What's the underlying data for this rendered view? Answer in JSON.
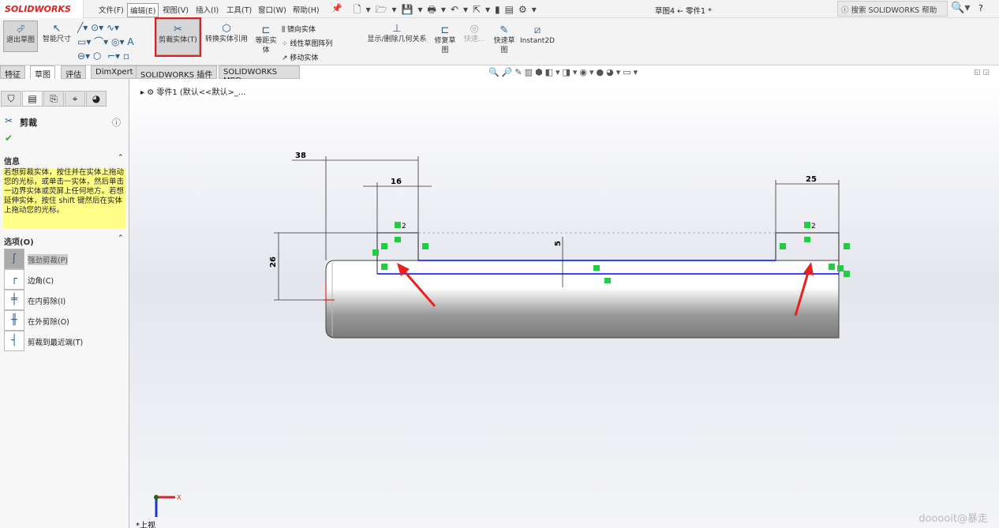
{
  "app": {
    "logo": "SOLIDWORKS",
    "title": "草图4 ← 零件1 *",
    "search_placeholder": "搜索 SOLIDWORKS 帮助",
    "help": "?"
  },
  "menu": [
    "文件(F)",
    "编辑(E)",
    "视图(V)",
    "插入(I)",
    "工具(T)",
    "窗口(W)",
    "帮助(H)"
  ],
  "ribbon": {
    "exit_sketch": "退出草图",
    "smart_dim": "智能尺寸",
    "trim": "剪裁实体(T)",
    "convert": "转换实体引用",
    "offset": "等距实体",
    "mirror": "镜向实体",
    "linear_pattern": "线性草图阵列",
    "move": "移动实体",
    "relations": "显示/删除几何关系",
    "repair": "修复草图",
    "quick_snap": "快速...",
    "rapid_sketch": "快速草图",
    "instant2d": "Instant2D"
  },
  "tabs": [
    "特征",
    "草图",
    "评估",
    "DimXpert",
    "SOLIDWORKS 插件",
    "SOLIDWORKS MBD"
  ],
  "tree": {
    "root": "零件1 (默认<<默认>_..."
  },
  "panel": {
    "title": "剪裁",
    "info_header": "信息",
    "info_text": "若想剪裁实体，按住并在实体上拖动您的光标，或单击一实体，然后单击一边界实体或荧屏上任何地方。若想延伸实体，按住 shift 键然后在实体上拖动您的光标。",
    "options_header": "选项(O)",
    "options": [
      {
        "label": "强劲剪裁(P)",
        "selected": true
      },
      {
        "label": "边角(C)"
      },
      {
        "label": "在内剪除(I)"
      },
      {
        "label": "在外剪除(O)"
      },
      {
        "label": "剪裁到最近端(T)"
      }
    ]
  },
  "drawing": {
    "dims": {
      "d38": "38",
      "d16": "16",
      "d25": "25",
      "d26": "26",
      "d5": "5"
    },
    "relation_label": "2",
    "view_label": "*上视",
    "axis_x": "X"
  },
  "colors": {
    "sketch_line": "#0000ff",
    "relation": "#22cc44",
    "arrow": "#e82020",
    "info_bg": "#ffff88"
  },
  "watermark": "dooooit@暴走"
}
